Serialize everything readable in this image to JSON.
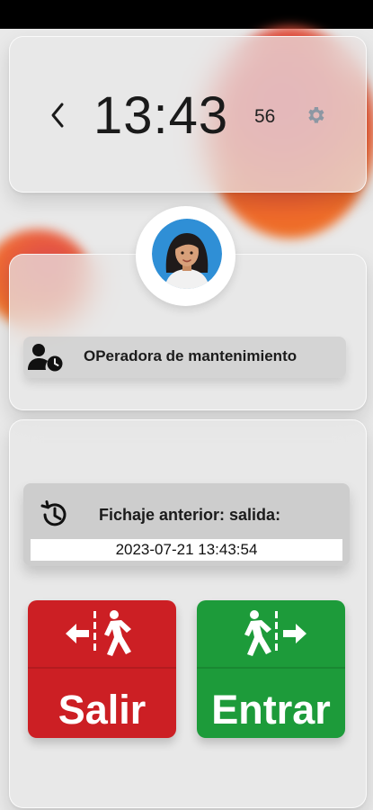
{
  "clock": {
    "time": "13:43",
    "seconds": "56"
  },
  "icons": {
    "back": "chevron-left-icon",
    "settings": "gear-icon",
    "role": "user-clock-icon",
    "history": "history-icon",
    "exit": "exit-walk-icon",
    "enter": "enter-walk-icon"
  },
  "profile": {
    "role": "OPeradora de mantenimiento"
  },
  "previous": {
    "label": "Fichaje anterior: salida",
    "value": "2023-07-21 13:43:54"
  },
  "buttons": {
    "exit": "Salir",
    "enter": "Entrar"
  },
  "colors": {
    "exit": "#cc1f24",
    "enter": "#1d9b3a",
    "settings": "#8c97a3"
  }
}
